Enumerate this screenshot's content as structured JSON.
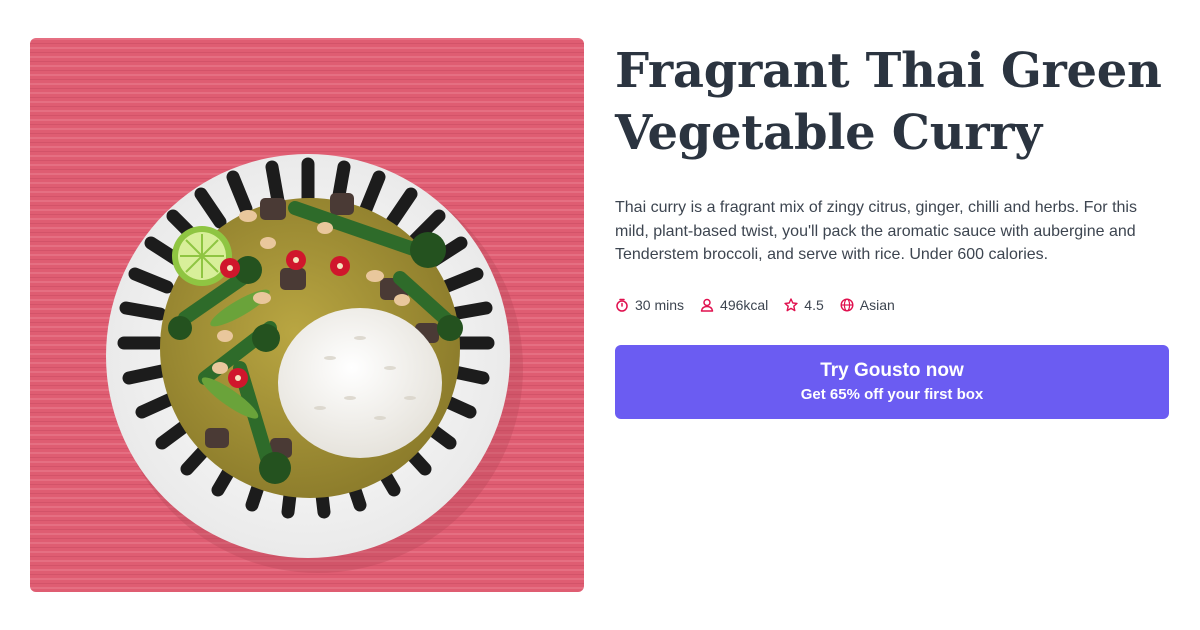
{
  "recipe": {
    "title": "Fragrant Thai Green Vegetable Curry",
    "description": "Thai curry is a fragrant mix of zingy citrus, ginger, chilli and herbs. For this mild, plant-based twist, you'll pack the aromatic sauce with aubergine and Tenderstem broccoli, and serve with rice. Under 600 calories.",
    "meta": {
      "time": "30 mins",
      "calories": "496kcal",
      "rating": "4.5",
      "cuisine": "Asian"
    }
  },
  "cta": {
    "primary_label": "Try Gousto now",
    "secondary_label": "Get 65% off your first box"
  },
  "colors": {
    "cta_background": "#6b5cf2",
    "icon_accent": "#e0114f",
    "title_text": "#2b3440"
  }
}
